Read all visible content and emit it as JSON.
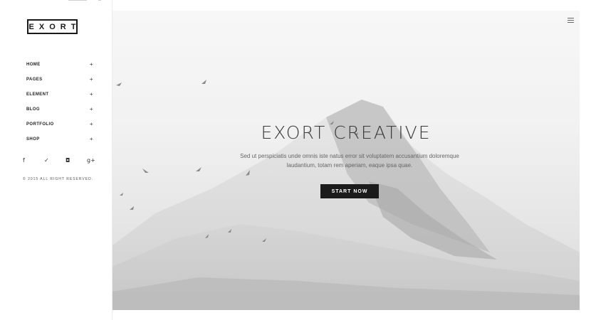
{
  "logo": {
    "text": "EXORT"
  },
  "nav": {
    "items": [
      {
        "label": "HOME",
        "expand": "+"
      },
      {
        "label": "PAGES",
        "expand": "+"
      },
      {
        "label": "ELEMENT",
        "expand": "+"
      },
      {
        "label": "BLOG",
        "expand": "+"
      },
      {
        "label": "PORTFOLIO",
        "expand": "+"
      },
      {
        "label": "SHOP",
        "expand": "+"
      }
    ]
  },
  "social": {
    "icons": [
      {
        "name": "facebook-icon",
        "glyph": "f"
      },
      {
        "name": "twitter-icon",
        "glyph": "✓"
      },
      {
        "name": "instagram-icon",
        "glyph": "◘"
      },
      {
        "name": "google-plus-icon",
        "glyph": "g+"
      }
    ]
  },
  "footer": {
    "copyright": "© 2015 ALL RIGHT RESERVED."
  },
  "hero": {
    "title": "EXORT CREATIVE",
    "text": "Sed ut perspiciatis unde omnis iste natus error sit voluptatem accusantium doloremque laudantium, totam rem aperiam, eaque ipsa quae.",
    "button": "START NOW"
  },
  "colors": {
    "accent": "#1b1b1b",
    "background": "#ffffff"
  }
}
